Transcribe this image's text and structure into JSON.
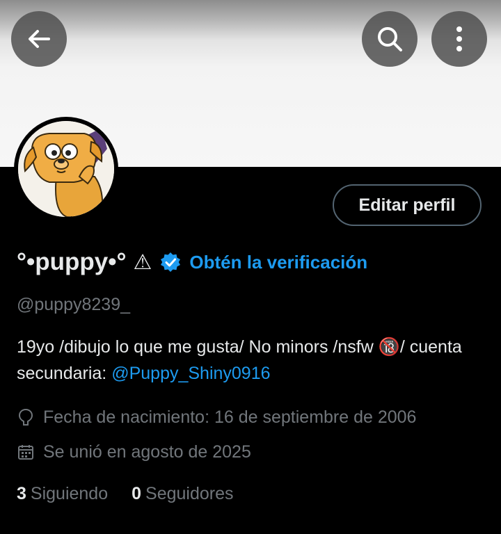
{
  "profile": {
    "display_name": "°•puppy•°",
    "warning_glyph": "⚠",
    "verify_link": "Obtén la verificación",
    "handle": "@puppy8239_",
    "bio_text": "19yo /dibujo lo que me gusta/ No minors /nsfw 🔞/ cuenta secundaria: ",
    "bio_mention": "@Puppy_Shiny0916",
    "birthdate": "Fecha de nacimiento: 16 de septiembre de 2006",
    "joined": "Se unió en agosto de 2025",
    "following_count": "3",
    "following_label": "Siguiendo",
    "followers_count": "0",
    "followers_label": "Seguidores"
  },
  "actions": {
    "edit_profile": "Editar perfil"
  },
  "colors": {
    "accent": "#1d9bf0",
    "muted": "#71767b",
    "text": "#e7e9ea",
    "background": "#000000"
  },
  "icons": [
    "back-arrow-icon",
    "search-icon",
    "more-vertical-icon",
    "verified-badge-icon",
    "location-pin-icon",
    "calendar-icon"
  ]
}
